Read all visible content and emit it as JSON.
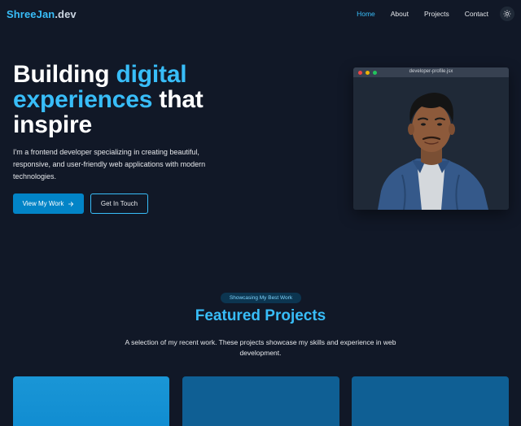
{
  "nav": {
    "logo_brand": "ShreeJan",
    "logo_tld": ".dev",
    "links": [
      {
        "label": "Home",
        "active": true
      },
      {
        "label": "About",
        "active": false
      },
      {
        "label": "Projects",
        "active": false
      },
      {
        "label": "Contact",
        "active": false
      }
    ],
    "theme_icon": "sun-icon"
  },
  "hero": {
    "title_part1": "Building ",
    "title_accent": "digital experiences",
    "title_part2": " that inspire",
    "description": "I'm a frontend developer specializing in creating beautiful, responsive, and user-friendly web applications with modern technologies.",
    "primary_button": "View My Work",
    "primary_button_icon": "arrow-right-icon",
    "secondary_button": "Get In Touch"
  },
  "profile_window": {
    "title": "developer-profile.jsx",
    "dots": [
      "#ef4444",
      "#eab308",
      "#22c55e"
    ]
  },
  "featured": {
    "badge": "Showcasing My Best Work",
    "title": "Featured Projects",
    "description": "A selection of my recent work. These projects showcase my skills and experience in web development."
  },
  "colors": {
    "background": "#111827",
    "accent": "#38bdf8",
    "primary_button": "#0284c7"
  }
}
